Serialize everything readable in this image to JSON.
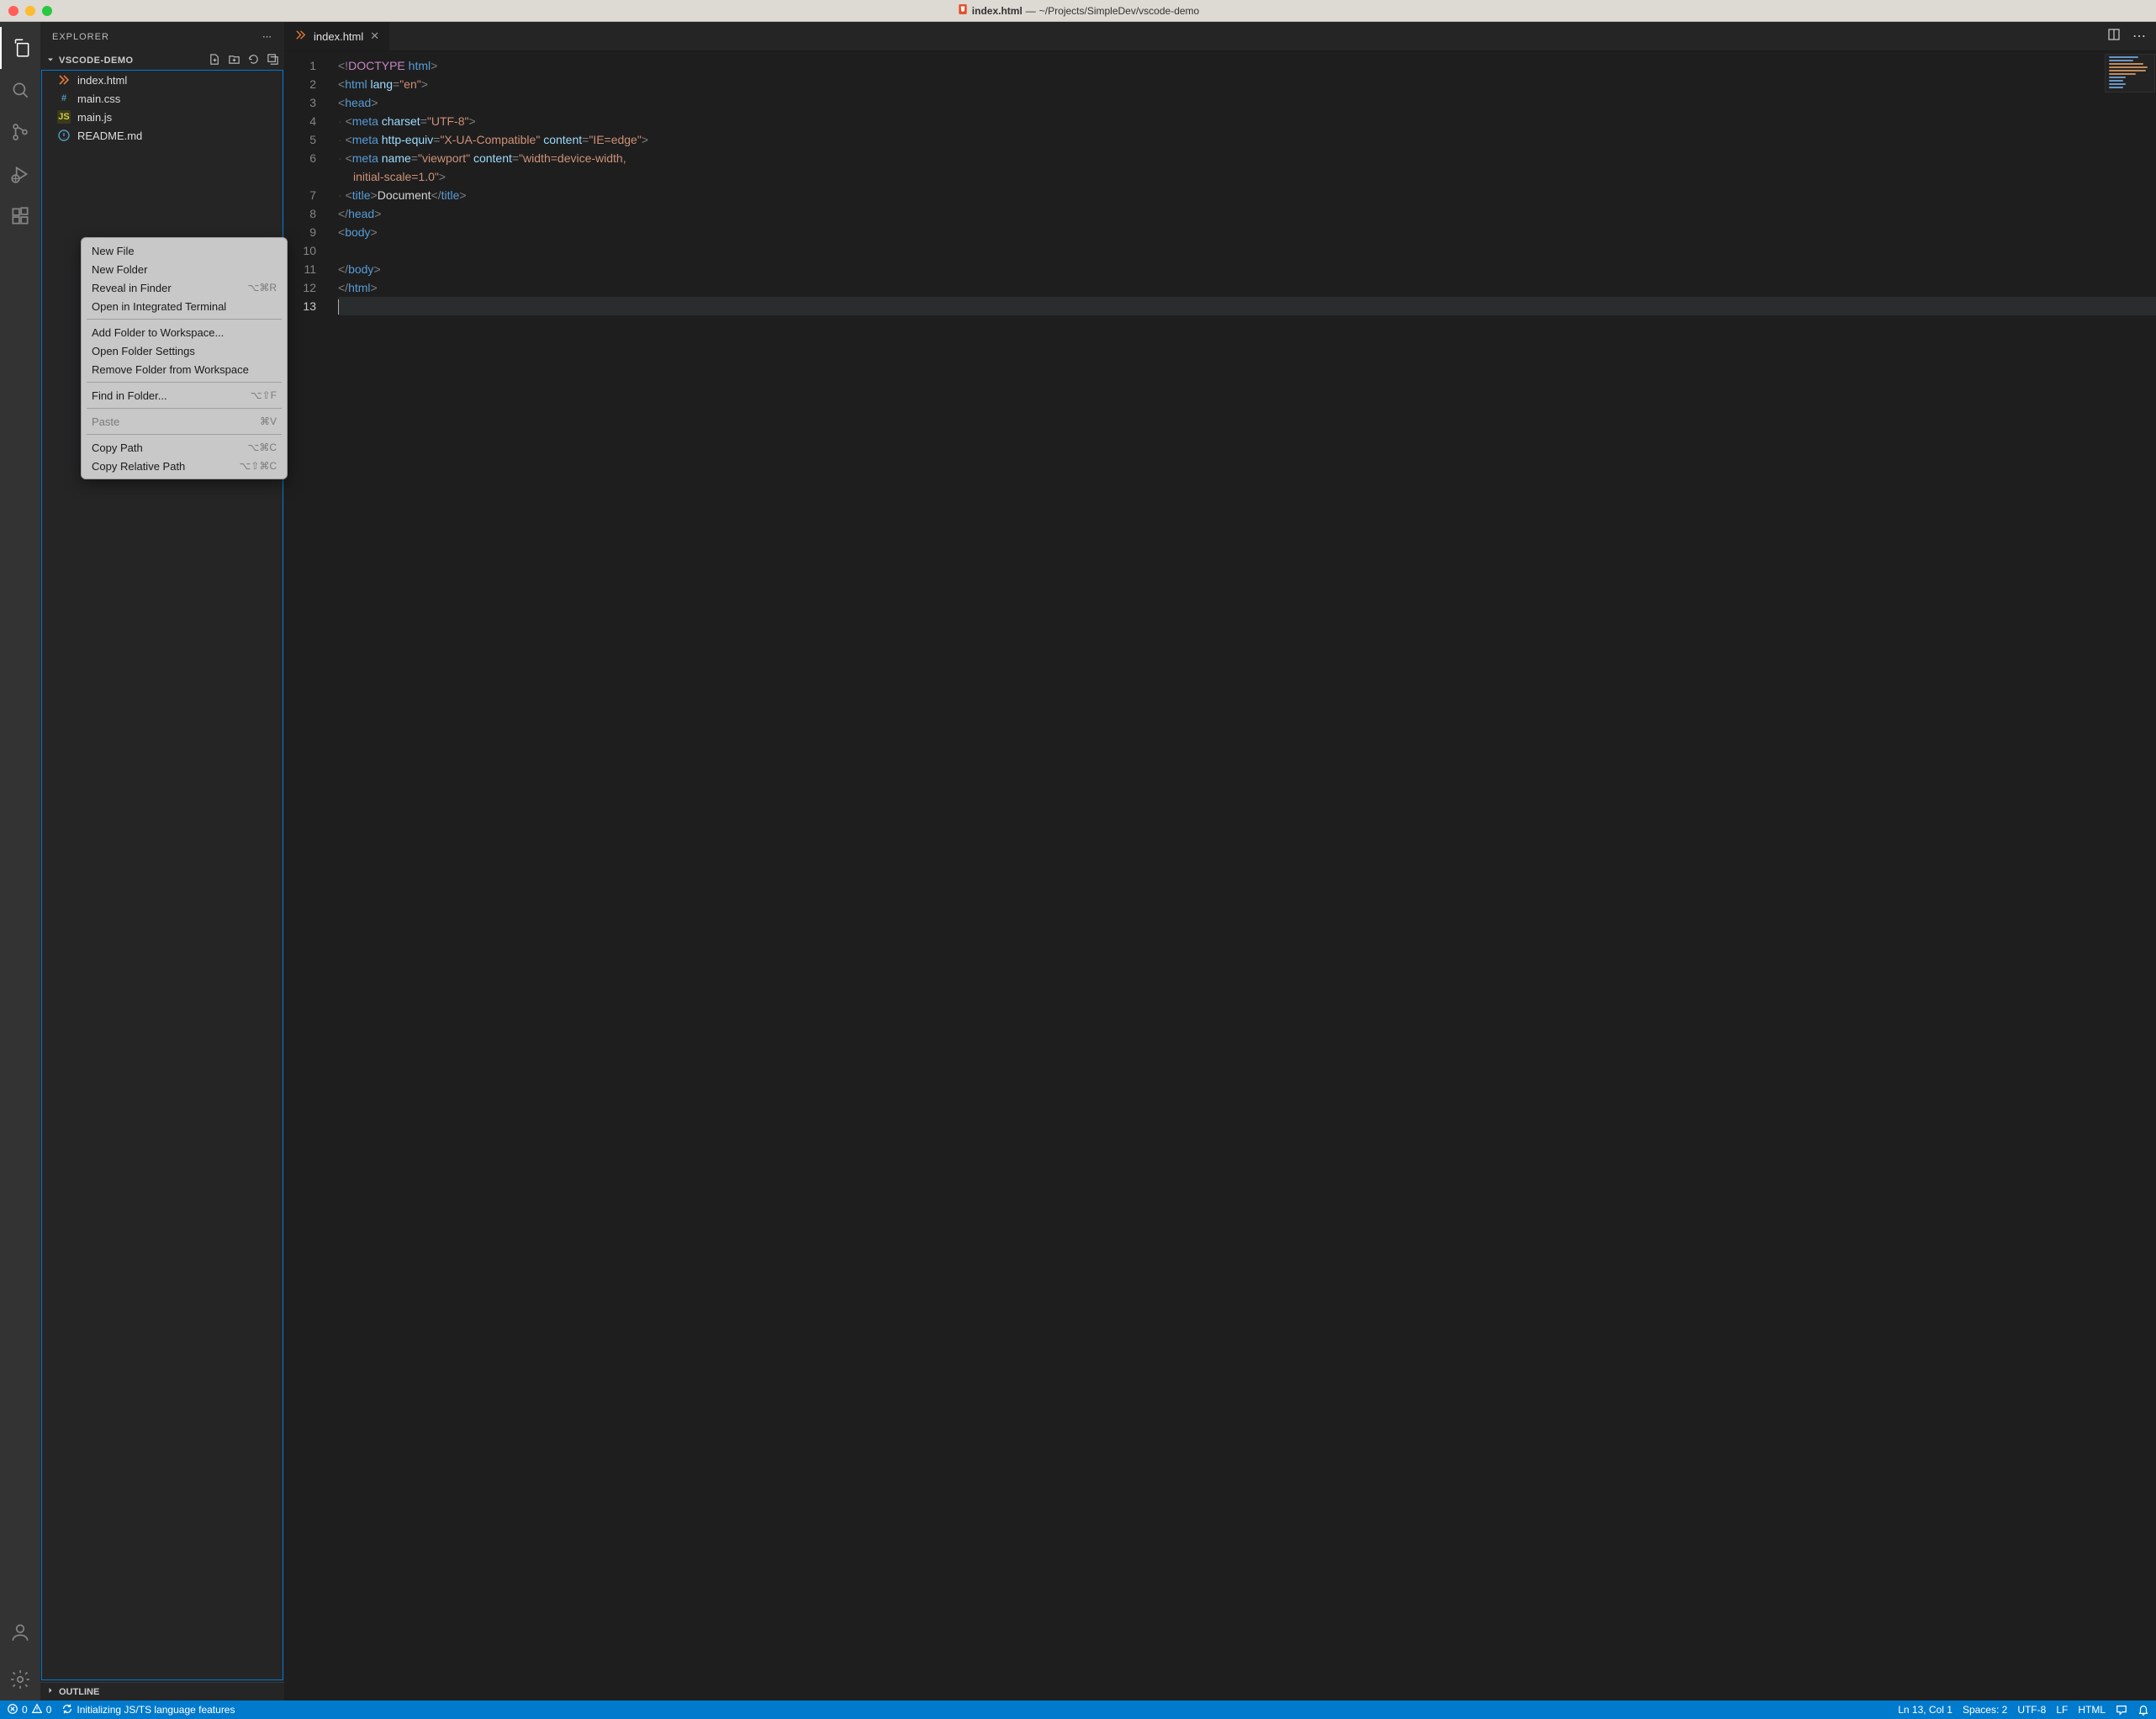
{
  "window": {
    "title_file": "index.html",
    "title_path": "~/Projects/SimpleDev/vscode-demo"
  },
  "activitybar": {
    "items": [
      "explorer",
      "search",
      "scm",
      "debug",
      "extensions"
    ]
  },
  "sidebar": {
    "title": "EXPLORER",
    "project": "VSCODE-DEMO",
    "files": [
      {
        "name": "index.html",
        "icon": "html"
      },
      {
        "name": "main.css",
        "icon": "css"
      },
      {
        "name": "main.js",
        "icon": "js"
      },
      {
        "name": "README.md",
        "icon": "md"
      }
    ],
    "outline": "OUTLINE"
  },
  "tabs": {
    "open": [
      {
        "name": "index.html"
      }
    ]
  },
  "editor": {
    "lines": [
      {
        "n": 1,
        "seg": [
          [
            "b",
            "<!"
          ],
          [
            "d",
            "DOCTYPE"
          ],
          [
            "x",
            " "
          ],
          [
            "t",
            "html"
          ],
          [
            "b",
            ">"
          ]
        ]
      },
      {
        "n": 2,
        "seg": [
          [
            "b",
            "<"
          ],
          [
            "t",
            "html"
          ],
          [
            "x",
            " "
          ],
          [
            "a",
            "lang"
          ],
          [
            "b",
            "="
          ],
          [
            "s",
            "\"en\""
          ],
          [
            "b",
            ">"
          ]
        ]
      },
      {
        "n": 3,
        "seg": [
          [
            "b",
            "<"
          ],
          [
            "t",
            "head"
          ],
          [
            "b",
            ">"
          ]
        ]
      },
      {
        "n": 4,
        "indent": 1,
        "seg": [
          [
            "b",
            "<"
          ],
          [
            "t",
            "meta"
          ],
          [
            "x",
            " "
          ],
          [
            "a",
            "charset"
          ],
          [
            "b",
            "="
          ],
          [
            "s",
            "\"UTF-8\""
          ],
          [
            "b",
            ">"
          ]
        ]
      },
      {
        "n": 5,
        "indent": 1,
        "seg": [
          [
            "b",
            "<"
          ],
          [
            "t",
            "meta"
          ],
          [
            "x",
            " "
          ],
          [
            "a",
            "http-equiv"
          ],
          [
            "b",
            "="
          ],
          [
            "s",
            "\"X-UA-Compatible\""
          ],
          [
            "x",
            " "
          ],
          [
            "a",
            "content"
          ],
          [
            "b",
            "="
          ],
          [
            "s",
            "\"IE=edge\""
          ],
          [
            "b",
            ">"
          ]
        ]
      },
      {
        "n": 6,
        "indent": 1,
        "seg": [
          [
            "b",
            "<"
          ],
          [
            "t",
            "meta"
          ],
          [
            "x",
            " "
          ],
          [
            "a",
            "name"
          ],
          [
            "b",
            "="
          ],
          [
            "s",
            "\"viewport\""
          ],
          [
            "x",
            " "
          ],
          [
            "a",
            "content"
          ],
          [
            "b",
            "="
          ],
          [
            "s",
            "\"width=device-width, "
          ]
        ]
      },
      {
        "n": 0,
        "wrap": true,
        "seg": [
          [
            "s",
            "initial-scale=1.0\""
          ],
          [
            "b",
            ">"
          ]
        ]
      },
      {
        "n": 7,
        "indent": 1,
        "seg": [
          [
            "b",
            "<"
          ],
          [
            "t",
            "title"
          ],
          [
            "b",
            ">"
          ],
          [
            "x",
            "Document"
          ],
          [
            "b",
            "</"
          ],
          [
            "t",
            "title"
          ],
          [
            "b",
            ">"
          ]
        ]
      },
      {
        "n": 8,
        "seg": [
          [
            "b",
            "</"
          ],
          [
            "t",
            "head"
          ],
          [
            "b",
            ">"
          ]
        ]
      },
      {
        "n": 9,
        "seg": [
          [
            "b",
            "<"
          ],
          [
            "t",
            "body"
          ],
          [
            "b",
            ">"
          ]
        ]
      },
      {
        "n": 10,
        "seg": []
      },
      {
        "n": 11,
        "seg": [
          [
            "b",
            "</"
          ],
          [
            "t",
            "body"
          ],
          [
            "b",
            ">"
          ]
        ]
      },
      {
        "n": 12,
        "seg": [
          [
            "b",
            "</"
          ],
          [
            "t",
            "html"
          ],
          [
            "b",
            ">"
          ]
        ]
      },
      {
        "n": 13,
        "cursor": true,
        "seg": []
      }
    ]
  },
  "context_menu": {
    "groups": [
      [
        {
          "label": "New File",
          "shortcut": ""
        },
        {
          "label": "New Folder",
          "shortcut": ""
        },
        {
          "label": "Reveal in Finder",
          "shortcut": "⌥⌘R"
        },
        {
          "label": "Open in Integrated Terminal",
          "shortcut": ""
        }
      ],
      [
        {
          "label": "Add Folder to Workspace...",
          "shortcut": ""
        },
        {
          "label": "Open Folder Settings",
          "shortcut": ""
        },
        {
          "label": "Remove Folder from Workspace",
          "shortcut": ""
        }
      ],
      [
        {
          "label": "Find in Folder...",
          "shortcut": "⌥⇧F"
        }
      ],
      [
        {
          "label": "Paste",
          "shortcut": "⌘V",
          "disabled": true
        }
      ],
      [
        {
          "label": "Copy Path",
          "shortcut": "⌥⌘C"
        },
        {
          "label": "Copy Relative Path",
          "shortcut": "⌥⇧⌘C"
        }
      ]
    ]
  },
  "statusbar": {
    "errors": "0",
    "warnings": "0",
    "task": "Initializing JS/TS language features",
    "position": "Ln 13, Col 1",
    "spaces": "Spaces: 2",
    "encoding": "UTF-8",
    "eol": "LF",
    "lang": "HTML"
  }
}
